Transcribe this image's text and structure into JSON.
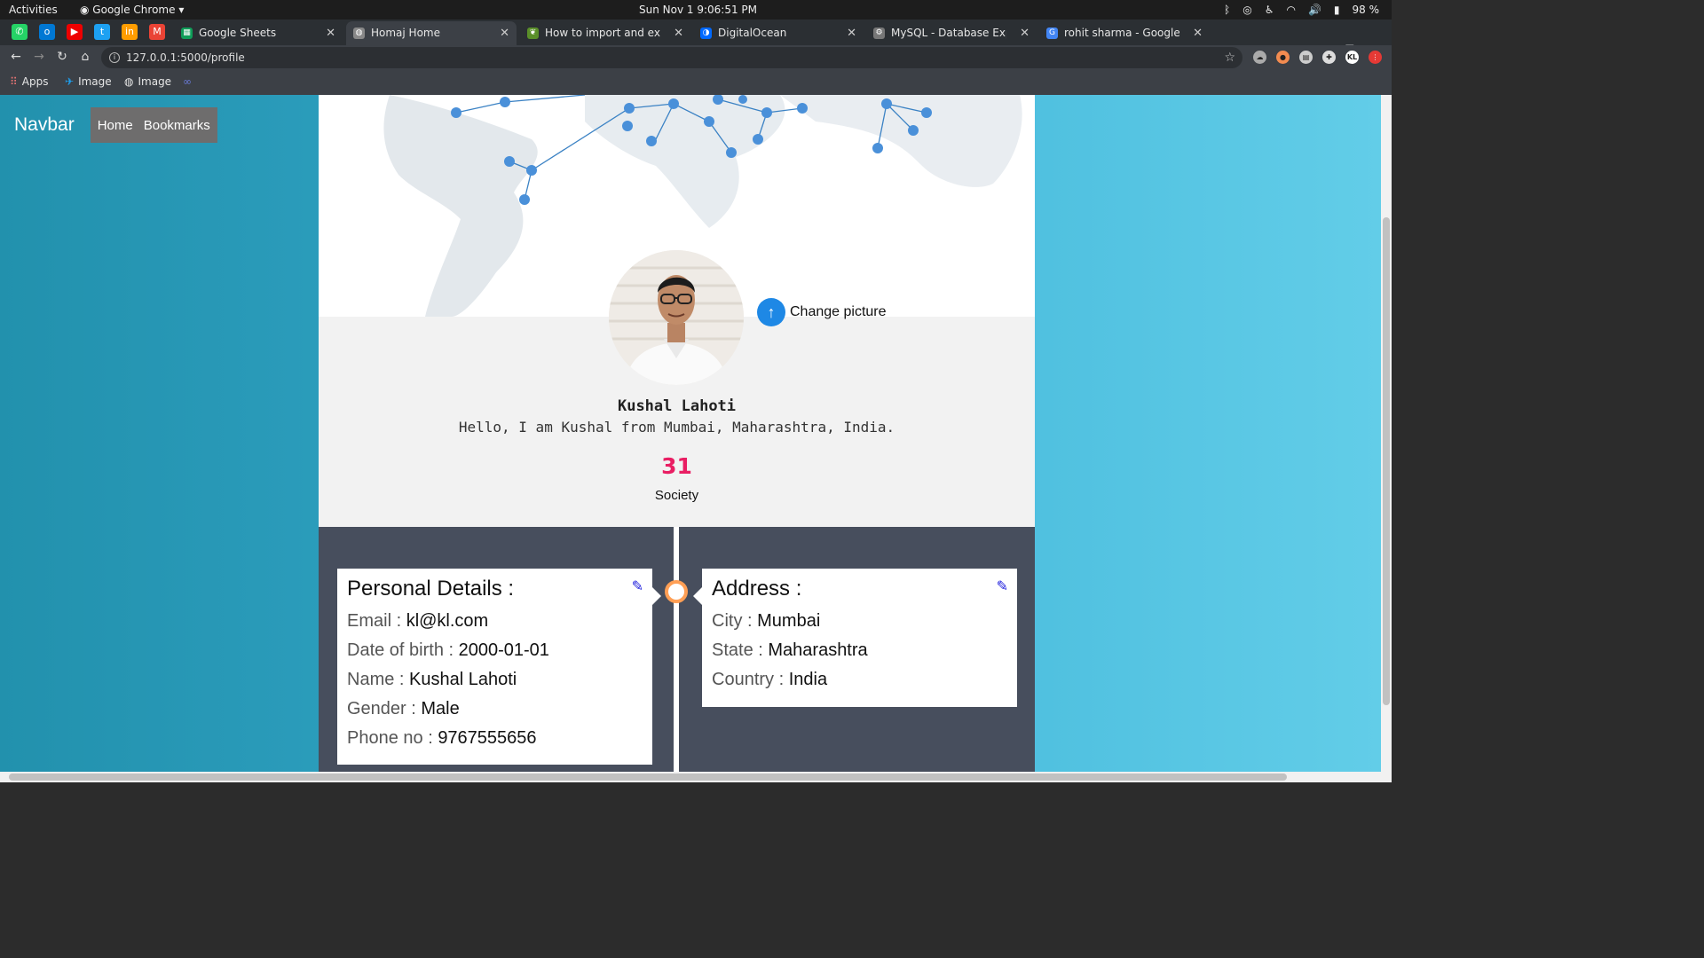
{
  "system": {
    "activities": "Activities",
    "app": "Google Chrome",
    "clock": "Sun Nov 1  9:06:51 PM",
    "battery": "98 %"
  },
  "tabs": [
    {
      "title": "Google Sheets"
    },
    {
      "title": "Homaj Home"
    },
    {
      "title": "How to import and expor"
    },
    {
      "title": "DigitalOcean"
    },
    {
      "title": "MySQL - Database Export"
    },
    {
      "title": "rohit sharma - Google Sea"
    }
  ],
  "address": {
    "url": "127.0.0.1:5000/profile",
    "avatar_initials": "KL"
  },
  "bookmarks": [
    {
      "label": "Apps"
    },
    {
      "label": "Image"
    },
    {
      "label": "Image"
    }
  ],
  "navbar": {
    "brand": "Navbar",
    "home": "Home",
    "bookmarks": "Bookmarks"
  },
  "profile": {
    "change_picture": "Change picture",
    "name": "Kushal Lahoti",
    "bio": "Hello, I am Kushal from Mumbai, Maharashtra, India.",
    "count": "31",
    "count_label": "Society"
  },
  "personal": {
    "heading": "Personal Details :",
    "rows": [
      {
        "label": "Email :",
        "value": "kl@kl.com"
      },
      {
        "label": "Date of birth :",
        "value": "2000-01-01"
      },
      {
        "label": "Name :",
        "value": "Kushal Lahoti"
      },
      {
        "label": "Gender :",
        "value": "Male"
      },
      {
        "label": "Phone no :",
        "value": "9767555656"
      }
    ]
  },
  "address_details": {
    "heading": "Address :",
    "rows": [
      {
        "label": "City :",
        "value": "Mumbai"
      },
      {
        "label": "State :",
        "value": "Maharashtra"
      },
      {
        "label": "Country :",
        "value": "India"
      }
    ]
  },
  "colors": {
    "accent_count": "#e91e63",
    "upload_button": "#1e88e5",
    "timeline_dot": "#ff9f55",
    "details_bg": "#474e5d"
  }
}
